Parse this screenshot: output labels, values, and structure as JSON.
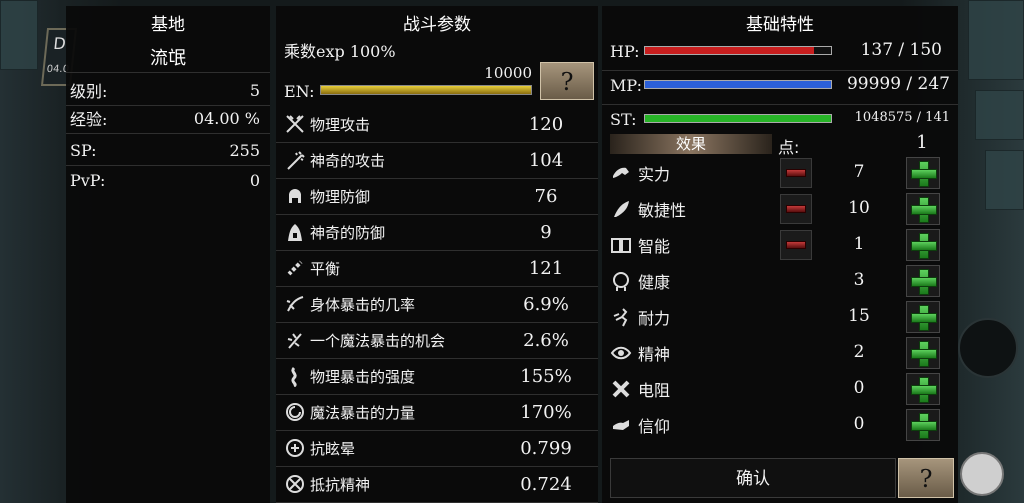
{
  "left": {
    "title": "基地",
    "name": "流氓",
    "rows": [
      {
        "label": "级别:",
        "value": "5"
      },
      {
        "label": "经验:",
        "value": "04.00  %"
      },
      {
        "label": "SP:",
        "value": "255"
      },
      {
        "label": "PvP:",
        "value": "0"
      }
    ]
  },
  "middle": {
    "title": "战斗参数",
    "exp_mult": "乘数exp 100%",
    "en_label": "EN:",
    "en_value": "10000",
    "help_button": "?",
    "stats": [
      {
        "icon": "swords-icon",
        "label": "物理攻击",
        "value": "120"
      },
      {
        "icon": "wand-icon",
        "label": "神奇的攻击",
        "value": "104"
      },
      {
        "icon": "helmet-icon",
        "label": "物理防御",
        "value": "76"
      },
      {
        "icon": "hood-icon",
        "label": "神奇的防御",
        "value": "9"
      },
      {
        "icon": "chain-icon",
        "label": "平衡",
        "value": "121"
      },
      {
        "icon": "crit-slash-icon",
        "label": "身体暴击的几率",
        "value": "6.9%"
      },
      {
        "icon": "magic-crit-icon",
        "label": "一个魔法暴击的机会",
        "value": "2.6%"
      },
      {
        "icon": "crit-power-icon",
        "label": "物理暴击的强度",
        "value": "155%"
      },
      {
        "icon": "vortex-icon",
        "label": "魔法暴击的力量",
        "value": "170%"
      },
      {
        "icon": "stun-resist-icon",
        "label": "抗眩晕",
        "value": "0.799"
      },
      {
        "icon": "mind-resist-icon",
        "label": "抵抗精神",
        "value": "0.724"
      }
    ]
  },
  "right": {
    "title": "基础特性",
    "hp": {
      "label": "HP:",
      "value": "137 / 150",
      "fill": 0.91,
      "color": "#c81e1e"
    },
    "mp": {
      "label": "MP:",
      "value": "99999 / 247",
      "fill": 1.0,
      "color": "#2b5fd8"
    },
    "st": {
      "label": "ST:",
      "value": "1048575 / 141",
      "fill": 1.0,
      "color": "#27b427"
    },
    "effects_tab": "效果",
    "points_label": "点:",
    "points_value": "1",
    "attributes": [
      {
        "icon": "arm-icon",
        "label": "实力",
        "value": "7",
        "minus": true
      },
      {
        "icon": "feather-icon",
        "label": "敏捷性",
        "value": "10",
        "minus": true
      },
      {
        "icon": "book-icon",
        "label": "智能",
        "value": "1",
        "minus": true
      },
      {
        "icon": "head-icon",
        "label": "健康",
        "value": "3",
        "minus": false
      },
      {
        "icon": "runner-icon",
        "label": "耐力",
        "value": "15",
        "minus": false
      },
      {
        "icon": "eye-icon",
        "label": "精神",
        "value": "2",
        "minus": false
      },
      {
        "icon": "crossed-bones-icon",
        "label": "电阻",
        "value": "0",
        "minus": false
      },
      {
        "icon": "praying-hands-icon",
        "label": "信仰",
        "value": "0",
        "minus": false
      }
    ],
    "confirm": "确认",
    "help_button": "?"
  }
}
